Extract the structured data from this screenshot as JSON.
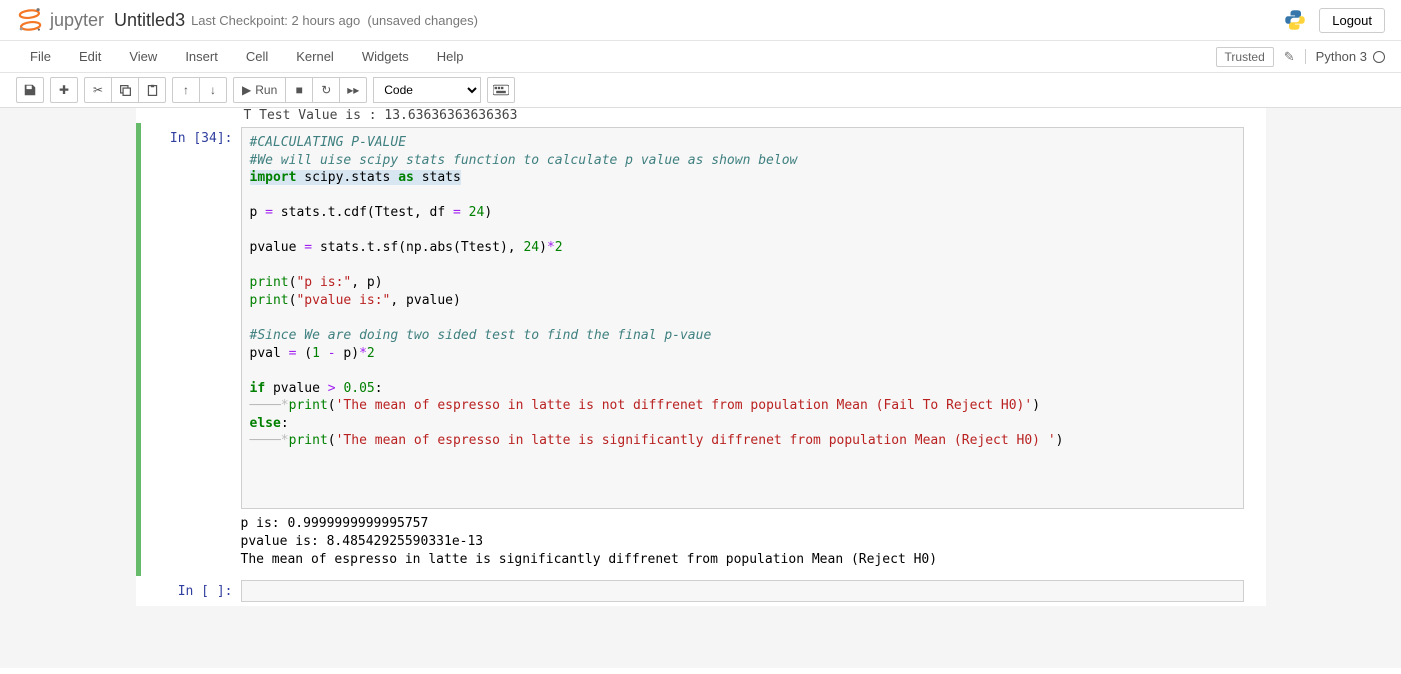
{
  "header": {
    "logo_text": "jupyter",
    "title": "Untitled3",
    "checkpoint": "Last Checkpoint: 2 hours ago",
    "unsaved": "(unsaved changes)",
    "logout": "Logout"
  },
  "menubar": {
    "items": [
      "File",
      "Edit",
      "View",
      "Insert",
      "Cell",
      "Kernel",
      "Widgets",
      "Help"
    ],
    "trusted": "Trusted",
    "kernel": "Python 3"
  },
  "toolbar": {
    "run_label": "Run",
    "cell_type": "Code"
  },
  "cells": {
    "partial_output": "T Test Value is :  13.63636363636363",
    "in34_prompt": "In [34]:",
    "in34_code": {
      "l1": "#CALCULATING P-VALUE",
      "l2": "#We will uise scipy stats function to calculate p value as shown below",
      "l3a": "import",
      "l3b": " scipy.stats ",
      "l3c": "as",
      "l3d": " stats",
      "l5a": "p ",
      "l5b": "=",
      "l5c": " stats.t.cdf(Ttest, df ",
      "l5d": "=",
      "l5e": " ",
      "l5f": "24",
      "l5g": ")",
      "l7a": "pvalue ",
      "l7b": "=",
      "l7c": " stats.t.sf(np.abs(Ttest), ",
      "l7d": "24",
      "l7e": ")",
      "l7f": "*",
      "l7g": "2",
      "l9a": "print",
      "l9b": "(",
      "l9c": "\"p is:\"",
      "l9d": ", p)",
      "l10a": "print",
      "l10b": "(",
      "l10c": "\"pvalue is:\"",
      "l10d": ", pvalue)",
      "l12": "#Since We are doing two sided test to find the final p-vaue",
      "l13a": "pval ",
      "l13b": "=",
      "l13c": " (",
      "l13d": "1",
      "l13e": " ",
      "l13f": "-",
      "l13g": " p)",
      "l13h": "*",
      "l13i": "2",
      "l15a": "if",
      "l15b": " pvalue ",
      "l15c": ">",
      "l15d": " ",
      "l15e": "0.05",
      "l15f": ":",
      "l16a": "    print",
      "l16b": "(",
      "l16c": "'The mean of espresso in latte is not diffrenet from population Mean (Fail To Reject H0)'",
      "l16d": ")",
      "l17a": "else",
      "l17b": ":",
      "l18a": "    print",
      "l18b": "(",
      "l18c": "'The mean of espresso in latte is significantly diffrenet from population Mean (Reject H0) '",
      "l18d": ")",
      "indent": "────*"
    },
    "in34_output": "p is: 0.9999999999995757\npvalue is: 8.48542925590331e-13\nThe mean of espresso in latte is significantly diffrenet from population Mean (Reject H0)",
    "empty_prompt": "In [ ]:"
  }
}
